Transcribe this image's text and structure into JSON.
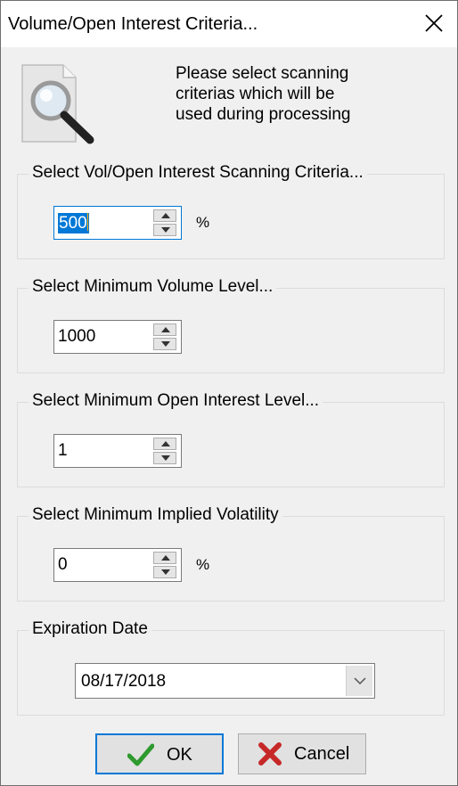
{
  "window": {
    "title": "Volume/Open Interest Criteria..."
  },
  "intro": {
    "text": "Please select scanning\ncriterias which will be\nused during processing"
  },
  "groups": {
    "vol_oi": {
      "label": "Select Vol/Open Interest Scanning Criteria...",
      "value": "500",
      "unit": "%"
    },
    "min_volume": {
      "label": "Select Minimum Volume Level...",
      "value": "1000"
    },
    "min_oi": {
      "label": "Select Minimum Open Interest Level...",
      "value": "1"
    },
    "min_iv": {
      "label": "Select Minimum Implied Volatility",
      "value": "0",
      "unit": "%"
    },
    "expiration": {
      "label": "Expiration Date",
      "value": "08/17/2018"
    }
  },
  "buttons": {
    "ok": "OK",
    "cancel": "Cancel"
  },
  "colors": {
    "focus": "#0078d7",
    "ok_check": "#2e9a2e",
    "cancel_x": "#c62828"
  },
  "icons": [
    "close-icon",
    "document-search-icon",
    "spin-up-icon",
    "spin-down-icon",
    "dropdown-chevron-icon",
    "checkmark-icon",
    "red-x-icon"
  ]
}
